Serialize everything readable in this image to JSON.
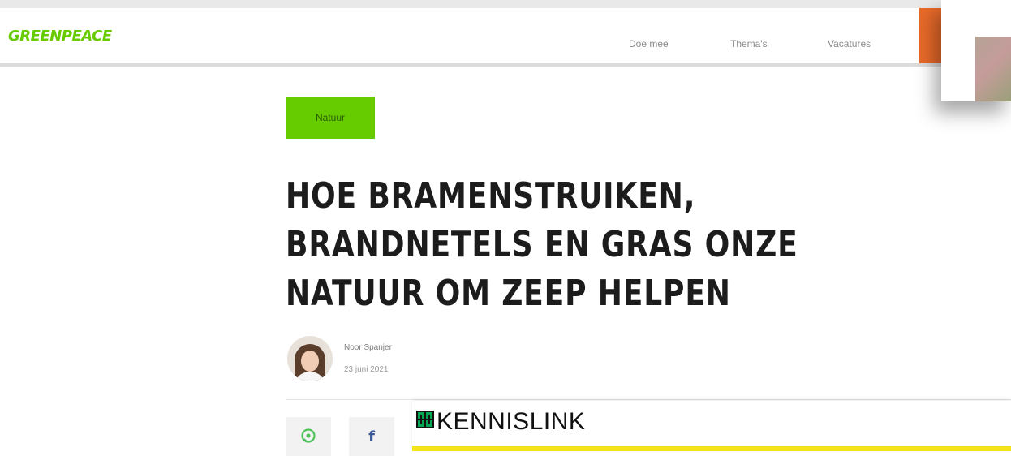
{
  "header": {
    "logo": "GREENPEACE",
    "nav": [
      "Doe mee",
      "Thema's",
      "Vacatures"
    ],
    "accent": "#66cc00",
    "cta_color": "#e96a2a"
  },
  "article": {
    "tag": "Natuur",
    "title": "HOE BRAMENSTRUIKEN, BRANDNETELS EN GRAS ONZE NATUUR OM ZEEP HELPEN",
    "author": "Noor Spanjer",
    "date": "23 juni 2021"
  },
  "share": {
    "icons": [
      "whatsapp-icon",
      "facebook-icon"
    ],
    "facebook_glyph": "f"
  },
  "kennislink": {
    "label": "KENNISLINK",
    "bar_color": "#f5e31a",
    "logo_color": "#00a651"
  }
}
